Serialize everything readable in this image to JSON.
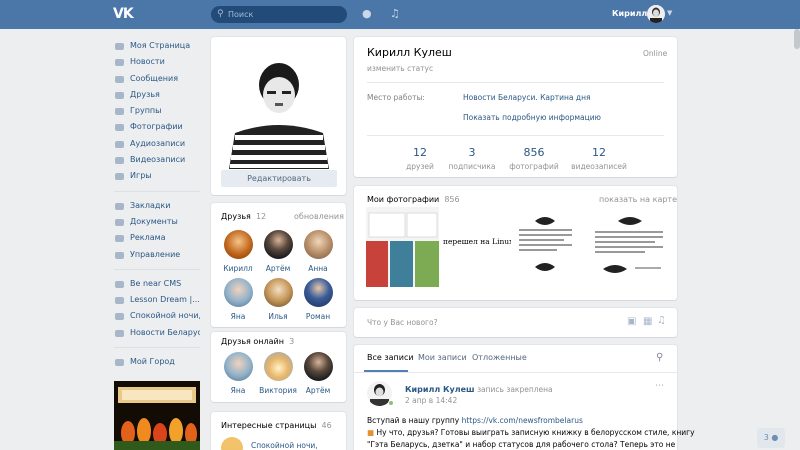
{
  "header": {
    "logo": "VK",
    "search_placeholder": "Поиск",
    "user_name": "Кирилл"
  },
  "sidebar": {
    "items": [
      {
        "label": "Моя Страница"
      },
      {
        "label": "Новости"
      },
      {
        "label": "Сообщения"
      },
      {
        "label": "Друзья"
      },
      {
        "label": "Группы"
      },
      {
        "label": "Фотографии"
      },
      {
        "label": "Аудиозаписи"
      },
      {
        "label": "Видеозаписи"
      },
      {
        "label": "Игры"
      }
    ],
    "items2": [
      {
        "label": "Закладки"
      },
      {
        "label": "Документы"
      },
      {
        "label": "Реклама"
      },
      {
        "label": "Управление"
      }
    ],
    "items3": [
      {
        "label": "Be near CMS"
      },
      {
        "label": "Lesson Dream |..."
      },
      {
        "label": "Спокойной ночи,..."
      },
      {
        "label": "Новости Беларус..."
      }
    ],
    "items4": [
      {
        "label": "Мой Город"
      }
    ]
  },
  "profile": {
    "edit_label": "Редактировать",
    "name": "Кирилл Кулеш",
    "status_hint": "изменить статус",
    "online": "Online",
    "work_label": "Место работы:",
    "work_value": "Новости Беларуси. Картина дня",
    "more_info": "Показать подробную информацию",
    "stats": [
      {
        "value": "12",
        "label": "друзей"
      },
      {
        "value": "3",
        "label": "подписчика"
      },
      {
        "value": "856",
        "label": "фотографий"
      },
      {
        "value": "12",
        "label": "видеозаписей"
      }
    ]
  },
  "friends": {
    "title": "Друзья",
    "count": "12",
    "updates": "обновления",
    "list": [
      {
        "name": "Кирилл"
      },
      {
        "name": "Артём"
      },
      {
        "name": "Анна"
      },
      {
        "name": "Яна"
      },
      {
        "name": "Илья"
      },
      {
        "name": "Роман"
      }
    ]
  },
  "friends_online": {
    "title": "Друзья онлайн",
    "count": "3",
    "list": [
      {
        "name": "Яна"
      },
      {
        "name": "Виктория"
      },
      {
        "name": "Артём"
      }
    ]
  },
  "interesting": {
    "title": "Интересные страницы",
    "count": "46",
    "item": "Спокойной ночи,"
  },
  "photos": {
    "title": "Мои фотографии",
    "count": "856",
    "map_link": "показать на карте",
    "thumb2_text": "перешел на Linux Mint."
  },
  "post_box": {
    "placeholder": "Что у Вас нового?"
  },
  "wall": {
    "tabs": [
      "Все записи",
      "Мои записи",
      "Отложенные"
    ],
    "author": "Кирилл Кулеш",
    "pinned": "запись закреплена",
    "date": "2 апр в 14:42",
    "line1_prefix": "Вступай в нашу группу ",
    "line1_link": "https://vk.com/newsfrombelarus",
    "line2": "Ну что, друзья? Готовы выиграть записную книжку в белорусском стиле, книгу",
    "line3": "\"Гэта Беларусь, дзетка\" и набор статусов для рабочего стола? Теперь это не"
  },
  "messenger": {
    "label": "3"
  },
  "colors": {
    "header": "#4a76a8",
    "link": "#2a5885",
    "background": "#edeef0"
  }
}
